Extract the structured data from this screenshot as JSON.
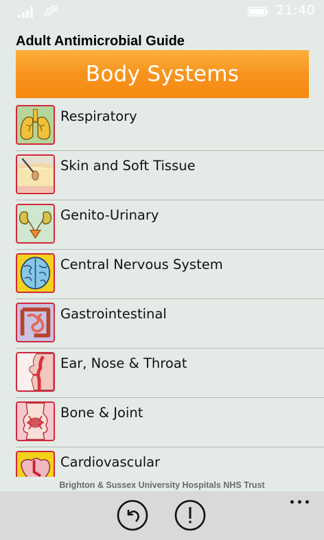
{
  "status_bar": {
    "time": "21:40"
  },
  "app": {
    "title": "Adult Antimicrobial Guide"
  },
  "banner": {
    "title": "Body Systems",
    "color": "#f7941d"
  },
  "items": [
    {
      "label": "Respiratory",
      "icon": "lungs-icon"
    },
    {
      "label": "Skin and Soft Tissue",
      "icon": "skin-icon"
    },
    {
      "label": "Genito-Urinary",
      "icon": "kidneys-icon"
    },
    {
      "label": "Central Nervous System",
      "icon": "brain-icon"
    },
    {
      "label": "Gastrointestinal",
      "icon": "intestines-icon"
    },
    {
      "label": "Ear, Nose & Throat",
      "icon": "ent-icon"
    },
    {
      "label": "Bone & Joint",
      "icon": "bone-joint-icon"
    },
    {
      "label": "Cardiovascular",
      "icon": "heart-icon"
    }
  ],
  "footer": {
    "text": "Brighton & Sussex University Hospitals NHS Trust"
  },
  "app_bar": {
    "buttons": [
      "undo-icon",
      "alert-icon",
      "more-icon"
    ]
  },
  "colors": {
    "background": "#e4ebe6",
    "icon_border": "#d0283c",
    "app_bar": "#d9d9d9"
  }
}
